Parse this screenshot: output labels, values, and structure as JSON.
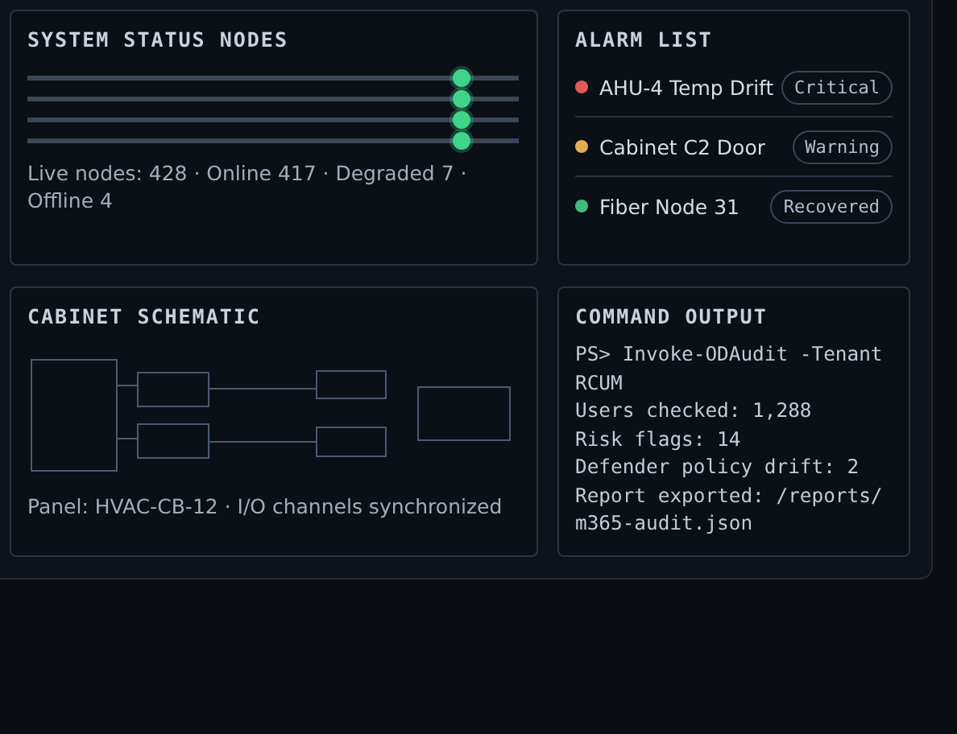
{
  "nodes": {
    "title": "SYSTEM STATUS NODES",
    "sliders": [
      {
        "level": 0.885
      },
      {
        "level": 0.885
      },
      {
        "level": 0.885
      },
      {
        "level": 0.885
      }
    ],
    "summary": "Live nodes: 428 · Online 417 · Degraded 7 · Offline 4"
  },
  "alarms": {
    "title": "ALARM LIST",
    "items": [
      {
        "name": "AHU-4 Temp Drift",
        "status": "Critical",
        "color": "#e05a5a"
      },
      {
        "name": "Cabinet C2 Door",
        "status": "Warning",
        "color": "#e0b050"
      },
      {
        "name": "Fiber Node 31",
        "status": "Recovered",
        "color": "#3fbf7f"
      }
    ]
  },
  "schematic": {
    "title": "CABINET SCHEMATIC",
    "caption": "Panel: HVAC-CB-12 · I/O channels synchronized"
  },
  "command": {
    "title": "COMMAND OUTPUT",
    "lines": [
      "PS> Invoke-ODAudit -Tenant RCUM",
      "Users checked: 1,288",
      "Risk flags: 14",
      "Defender policy drift: 2",
      "Report exported: /reports/m365-audit.json"
    ]
  }
}
